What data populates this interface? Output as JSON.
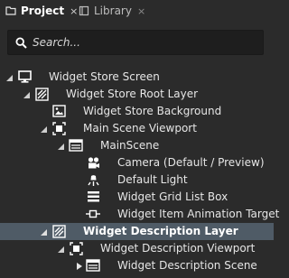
{
  "tabs": [
    {
      "label": "Project",
      "active": true,
      "icon": "folder-icon"
    },
    {
      "label": "Library",
      "active": false,
      "icon": "book-icon"
    }
  ],
  "close_glyph": "×",
  "search": {
    "placeholder": "Search...",
    "value": ""
  },
  "tree": {
    "items": [
      {
        "label": "Widget Store Screen",
        "icon": "monitor-icon",
        "expanded": true
      },
      {
        "label": "Widget Store Root Layer",
        "icon": "layer-icon",
        "expanded": true
      },
      {
        "label": "Widget Store Background",
        "icon": "image-icon"
      },
      {
        "label": "Main Scene Viewport",
        "icon": "viewport-icon",
        "expanded": true
      },
      {
        "label": "MainScene",
        "icon": "scene-icon",
        "expanded": true
      },
      {
        "label": "Camera (Default / Preview)",
        "icon": "camera-icon"
      },
      {
        "label": "Default Light",
        "icon": "light-icon"
      },
      {
        "label": "Widget Grid List Box",
        "icon": "grid-list-icon"
      },
      {
        "label": "Widget Item Animation Target",
        "icon": "animation-target-icon"
      },
      {
        "label": "Widget Description Layer",
        "icon": "layer-icon",
        "expanded": true,
        "selected": true
      },
      {
        "label": "Widget Description Viewport",
        "icon": "viewport-icon",
        "expanded": true
      },
      {
        "label": "Widget Description Scene",
        "icon": "scene-icon",
        "expanded": false
      }
    ]
  },
  "colors": {
    "background": "#2b2b2b",
    "selection": "#4f5b66",
    "search_bg": "#1e1e1e"
  }
}
